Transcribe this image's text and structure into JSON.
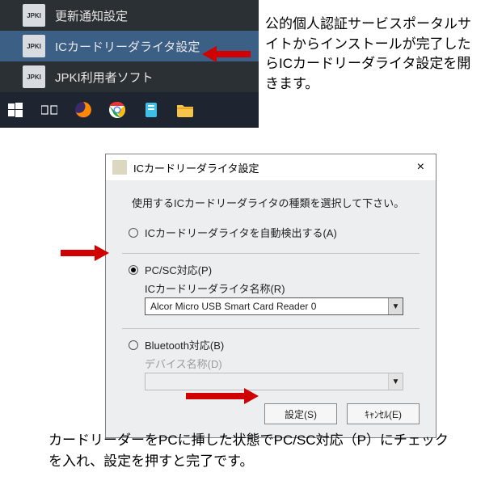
{
  "startmenu": {
    "items": [
      {
        "label": "更新通知設定",
        "icon": "JPKI"
      },
      {
        "label": "ICカードリーダライタ設定",
        "icon": "JPKI"
      },
      {
        "label": "JPKI利用者ソフト",
        "icon": "JPKI"
      }
    ]
  },
  "annotation1": "公的個人認証サービスポータルサイトからインストールが完了したらICカードリーダライタ設定を開きます。",
  "dialog": {
    "title": "ICカードリーダライタ設定",
    "instruction": "使用するICカードリーダライタの種類を選択して下さい。",
    "opt_auto": "ICカードリーダライタを自動検出する(A)",
    "opt_pcsc": "PC/SC対応(P)",
    "pcsc_namelabel": "ICカードリーダライタ名称(R)",
    "pcsc_value": "Alcor Micro USB Smart Card Reader 0",
    "opt_bt": "Bluetooth対応(B)",
    "bt_namelabel": "デバイス名称(D)",
    "btn_set": "設定(S)",
    "btn_cancel": "ｷｬﾝｾﾙ(E)",
    "close": "×"
  },
  "annotation2": "カードリーダーをPCに挿した状態でPC/SC対応（P）にチェックを入れ、設定を押すと完了です。"
}
